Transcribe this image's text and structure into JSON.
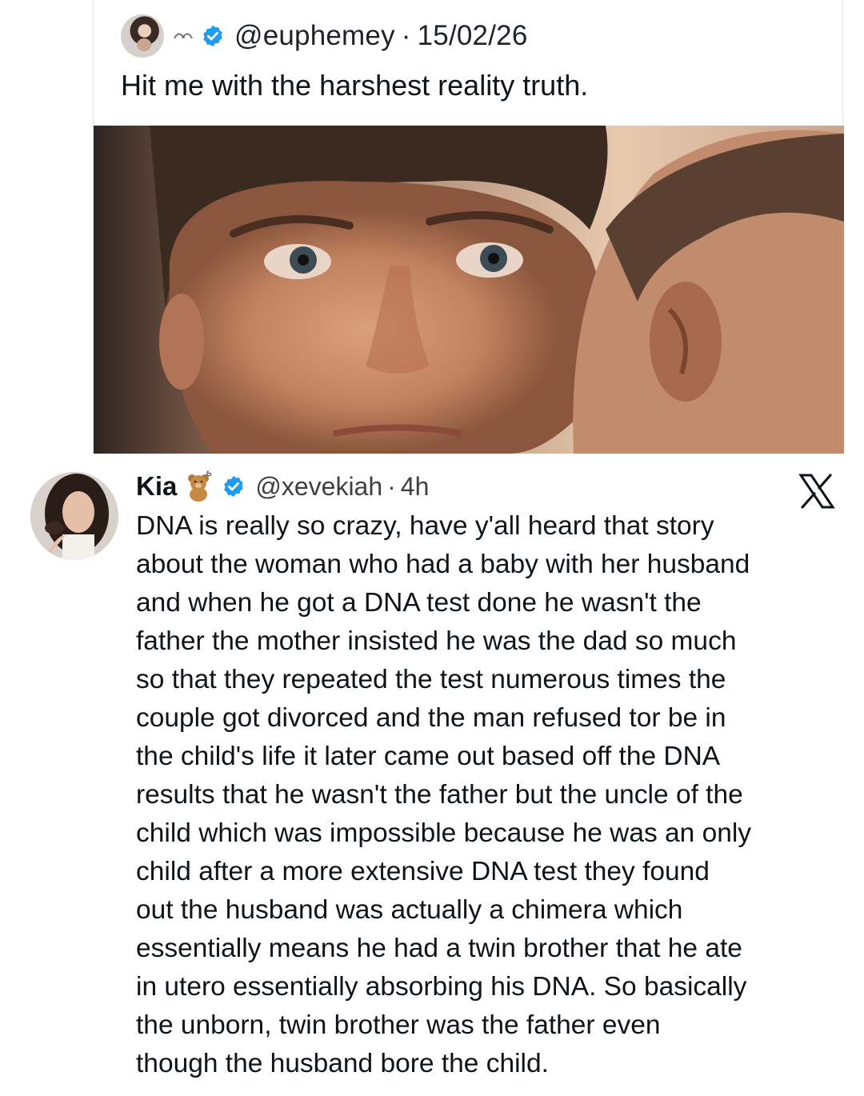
{
  "quoted_tweet": {
    "handle": "@euphemey",
    "date": "15/02/26",
    "separator": "·",
    "text": "Hit me with the harshest reality truth."
  },
  "reply_tweet": {
    "name": "Kia",
    "handle": "@xevekiah",
    "separator": "·",
    "time": "4h",
    "lines": [
      "DNA is really so crazy, have y'all heard that story",
      "about the woman who had a baby with her husband",
      "and when he got a DNA test done he wasn't the",
      "father the mother insisted he was the dad so much",
      "so that they repeated the test numerous times the",
      "couple got divorced and the man refused tor be in",
      "the child's life it later came out based off the DNA",
      "results that he wasn't the father but the uncle of the",
      "child which was impossible because he was an only",
      "child after a more extensive DNA test they found",
      "out the husband was actually a chimera which",
      "essentially means he had a twin brother that he ate",
      "in utero essentially absorbing his DNA. So basically",
      "the unborn, twin brother was the father even",
      "though the husband bore the child."
    ]
  },
  "icons": {
    "verified": "verified-badge-icon",
    "bear": "teddy-bear-icon",
    "platform": "x-logo-icon"
  },
  "colors": {
    "verified_blue": "#1d9bf0",
    "text": "#0f1419",
    "muted": "#3c4043"
  }
}
